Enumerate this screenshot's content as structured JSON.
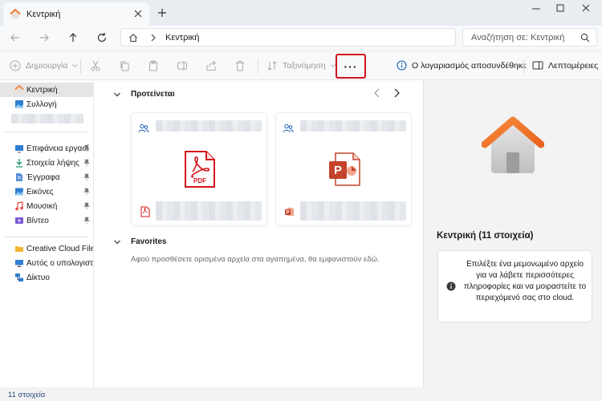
{
  "tab": {
    "title": "Κεντρική",
    "icon": "home-icon"
  },
  "address": {
    "breadcrumb": "Κεντρική"
  },
  "search": {
    "placeholder": "Αναζήτηση σε: Κεντρική"
  },
  "toolbar": {
    "new_label": "Δημιουργία",
    "sort_label": "Ταξινόμηση",
    "more_label": "···",
    "account_label": "Ο λογαριασμός αποσυνδέθηκε",
    "details_label": "Λεπτομέρειες"
  },
  "sidebar": {
    "top_items": [
      {
        "label": "Κεντρική",
        "icon": "home-icon"
      },
      {
        "label": "Συλλογή",
        "icon": "gallery-icon"
      }
    ],
    "pinned_items": [
      {
        "label": "Επιφάνεια εργασί",
        "icon": "desktop-icon"
      },
      {
        "label": "Στοιχεία λήψης",
        "icon": "download-icon"
      },
      {
        "label": "Έγγραφα",
        "icon": "documents-icon"
      },
      {
        "label": "Εικόνες",
        "icon": "pictures-icon"
      },
      {
        "label": "Μουσική",
        "icon": "music-icon"
      },
      {
        "label": "Βίντεο",
        "icon": "video-icon"
      }
    ],
    "other_items": [
      {
        "label": "Creative Cloud Files P",
        "icon": "folder-icon"
      },
      {
        "label": "Αυτός ο υπολογιστής",
        "icon": "computer-icon"
      },
      {
        "label": "Δίκτυο",
        "icon": "network-icon"
      }
    ]
  },
  "main": {
    "recommended_title": "Προτείνεται",
    "cards": [
      {
        "type": "pdf",
        "badge": "PDF"
      },
      {
        "type": "powerpoint",
        "badge": "P"
      }
    ],
    "favorites_title": "Favorites",
    "favorites_message": "Αφού προσθέσετε ορισμένα αρχεία στα αγαπημένα, θα εμφανιστούν εδώ."
  },
  "details": {
    "header": "Κεντρική (11 στοιχεία)",
    "info": "Επιλέξτε ένα μεμονωμένο αρχείο για να λάβετε περισσότερες πληροφορίες και να μοιραστείτε το περιεχόμενό σας στο cloud."
  },
  "status": {
    "count": "11 στοιχεία"
  },
  "colors": {
    "accent": "#d4141c",
    "pdf": "#d4141c",
    "ppt": "#c4432a",
    "folder": "#f2b632",
    "home_roof": "#f07a2e"
  }
}
